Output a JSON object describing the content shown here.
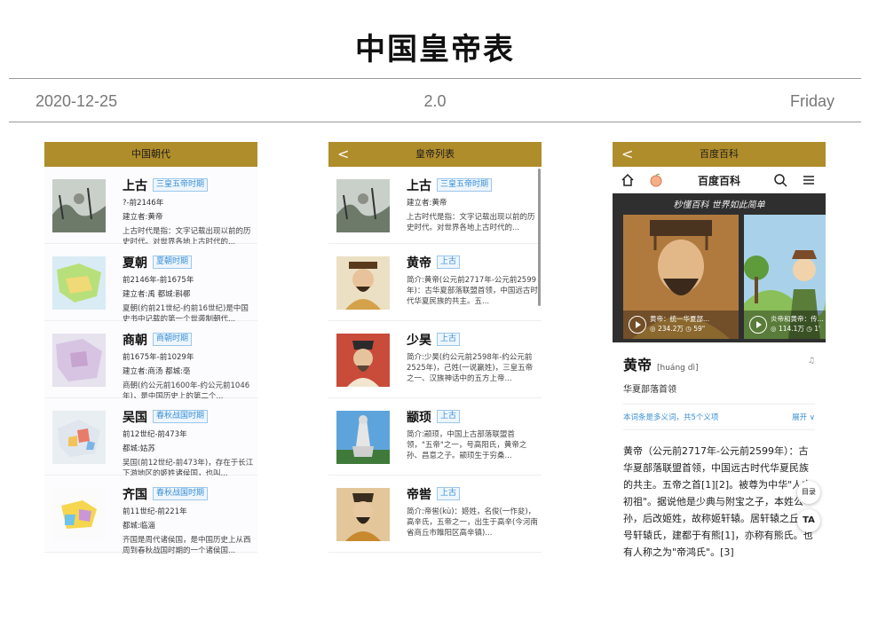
{
  "page": {
    "title": "中国皇帝表",
    "date": "2020-12-25",
    "version": "2.0",
    "weekday": "Friday"
  },
  "panel1": {
    "header": "中国朝代",
    "items": [
      {
        "name": "上古",
        "tag": "三皇五帝时期",
        "line1": "?-前2146年",
        "line2": "建立者:黄帝",
        "desc": "上古时代是指：文字记载出现以前的历史时代。对世界各地上古时代的..."
      },
      {
        "name": "夏朝",
        "tag": "夏朝时期",
        "line1": "前2146年-前1675年",
        "line2": "建立者:禹 都城:斟鄩",
        "desc": "夏朝(约前21世纪-约前16世纪)是中国史书中记载的第一个世袭制朝代..."
      },
      {
        "name": "商朝",
        "tag": "商朝时期",
        "line1": "前1675年-前1029年",
        "line2": "建立者:商汤 都城:亳",
        "desc": "商朝(约公元前1600年-约公元前1046年)，是中国历史上的第二个..."
      },
      {
        "name": "吴国",
        "tag": "春秋战国时期",
        "line1": "前12世纪-前473年",
        "line2": "都城:姑苏",
        "desc": "吴国(前12世纪-前473年)，存在于长江下游地区的姬姓诸侯国，也叫..."
      },
      {
        "name": "齐国",
        "tag": "春秋战国时期",
        "line1": "前11世纪-前221年",
        "line2": "都城:临淄",
        "desc": "齐国是周代诸侯国，是中国历史上从西周到春秋战国时期的一个诸侯国..."
      }
    ]
  },
  "panel2": {
    "header": "皇帝列表",
    "back": "<",
    "items": [
      {
        "name": "上古",
        "tag": "三皇五帝时期",
        "line1": "建立者:黄帝",
        "desc": "上古时代是指：文字记载出现以前的历史时代。对世界各地上古时代的..."
      },
      {
        "name": "黄帝",
        "tag": "上古",
        "desc": "简介:黄帝(公元前2717年-公元前2599年)：古华夏部落联盟首领，中国远古时代华夏民族的共主。五..."
      },
      {
        "name": "少昊",
        "tag": "上古",
        "desc": "简介:少昊(约公元前2598年-约公元前2525年)，己姓(一说嬴姓)，三皇五帝之一、汉族神话中的五方上帝..."
      },
      {
        "name": "颛顼",
        "tag": "上古",
        "desc": "简介:颛顼，中国上古部落联盟首领，\"五帝\"之一，号高阳氏，黄帝之孙、昌意之子。颛顼生于穷桑..."
      },
      {
        "name": "帝喾",
        "tag": "上古",
        "desc": "简介:帝喾(kù)：姬姓，名俊(一作夋)，高辛氏，五帝之一，出生于高辛(今河南省商丘市睢阳区高辛镇)..."
      }
    ]
  },
  "panel3": {
    "header": "百度百科",
    "back": "<",
    "brand": "百度百科",
    "banner": "秒懂百科  世界如此简单",
    "videos": [
      {
        "caption": "黄帝：统一华夏部...",
        "views": "234.2万",
        "duration": "59\""
      },
      {
        "caption": "炎帝和黄帝：传...",
        "views": "114.1万",
        "duration": "1'"
      }
    ],
    "entry": {
      "title": "黄帝",
      "pinyin": "[huáng dì]",
      "subtitle": "华夏部落首领",
      "polysemy": "本词条是多义词，共5个义项",
      "expand": "展开 ∨"
    },
    "body": "黄帝（公元前2717年-公元前2599年）：古华夏部落联盟首领，中国远古时代华夏民族的共主。五帝之首[1][2]。被尊为中华\"人文初祖\"。据说他是少典与附宝之子，本姓公孙，后改姬姓，故称姬轩辕。居轩辕之丘，号轩辕氏，建都于有熊[1]，亦称有熊氏。也有人称之为\"帝鸿氏\"。[3]",
    "float_toc": "目录",
    "float_ta": "TA"
  }
}
